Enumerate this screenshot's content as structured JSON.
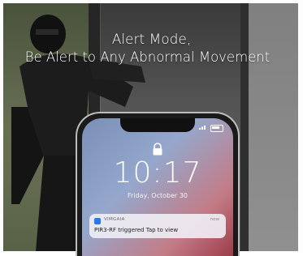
{
  "headline": {
    "line1": "Alert Mode,",
    "line2": "Be Alert to Any Abnormal Movement"
  },
  "phone": {
    "time": "10:17",
    "date": "Friday, October 30",
    "notification": {
      "app": "VIMGAIA",
      "when": "now",
      "message": "PIR3-RF triggered Tap to view"
    }
  },
  "icons": {
    "lock": "lock-icon",
    "battery": "battery-icon",
    "signal": "signal-icon",
    "app": "app-icon"
  },
  "colors": {
    "headline_text": "#ffffff",
    "notification_accent": "#2c7be5"
  }
}
